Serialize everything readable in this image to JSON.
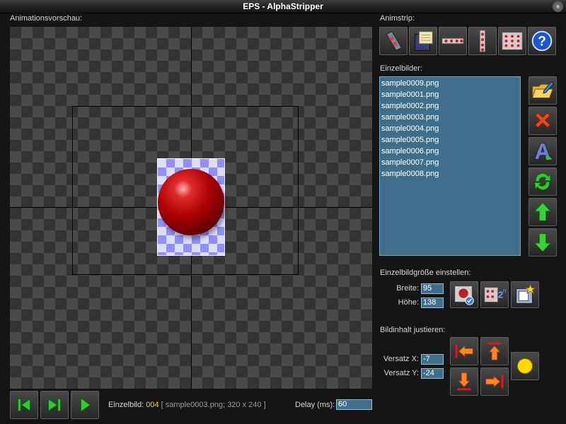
{
  "window": {
    "title": "EPS - AlphaStripper",
    "close_glyph": "×"
  },
  "preview": {
    "label": "Animationsvorschau:"
  },
  "animstrip": {
    "label": "Animstrip:",
    "buttons": [
      "film-strip-icon",
      "save-disk-icon",
      "horizontal-strip-icon",
      "vertical-strip-icon",
      "grid-strip-icon",
      "help-icon"
    ]
  },
  "frames": {
    "label": "Einzelbilder:",
    "items": [
      "sample0009.png",
      "sample0001.png",
      "sample0002.png",
      "sample0003.png",
      "sample0004.png",
      "sample0005.png",
      "sample0006.png",
      "sample0007.png",
      "sample0008.png"
    ],
    "side_buttons": [
      "open-folder-icon",
      "delete-icon",
      "rename-icon",
      "refresh-icon",
      "move-up-icon",
      "move-down-icon"
    ]
  },
  "size": {
    "label": "Einzelbildgröße einstellen:",
    "width_label": "Breite:",
    "width_value": "95",
    "height_label": "Höhe:",
    "height_value": "138",
    "buttons": [
      "auto-size-icon",
      "power-of-two-icon",
      "crop-icon"
    ]
  },
  "adjust": {
    "label": "Bildinhalt justieren:",
    "offset_x_label": "Versatz X:",
    "offset_x_value": "-7",
    "offset_y_label": "Versatz Y:",
    "offset_y_value": "-24",
    "buttons": [
      "align-left-icon",
      "align-top-icon",
      "align-bottom-icon",
      "align-right-icon",
      "center-icon"
    ]
  },
  "status": {
    "frame_label": "Einzelbild:",
    "frame_index": "004",
    "frame_info": "[ sample0003.png; 320 x 240 ]",
    "delay_label": "Delay (ms):",
    "delay_value": "60"
  },
  "playback": {
    "buttons": [
      "skip-to-start-icon",
      "step-forward-icon",
      "play-icon"
    ]
  },
  "colors": {
    "list_bg": "#3f6f8c",
    "accent_yellow": "#ffd800",
    "arrow_green": "#2ecc2e",
    "arrow_red": "#e8141b"
  }
}
